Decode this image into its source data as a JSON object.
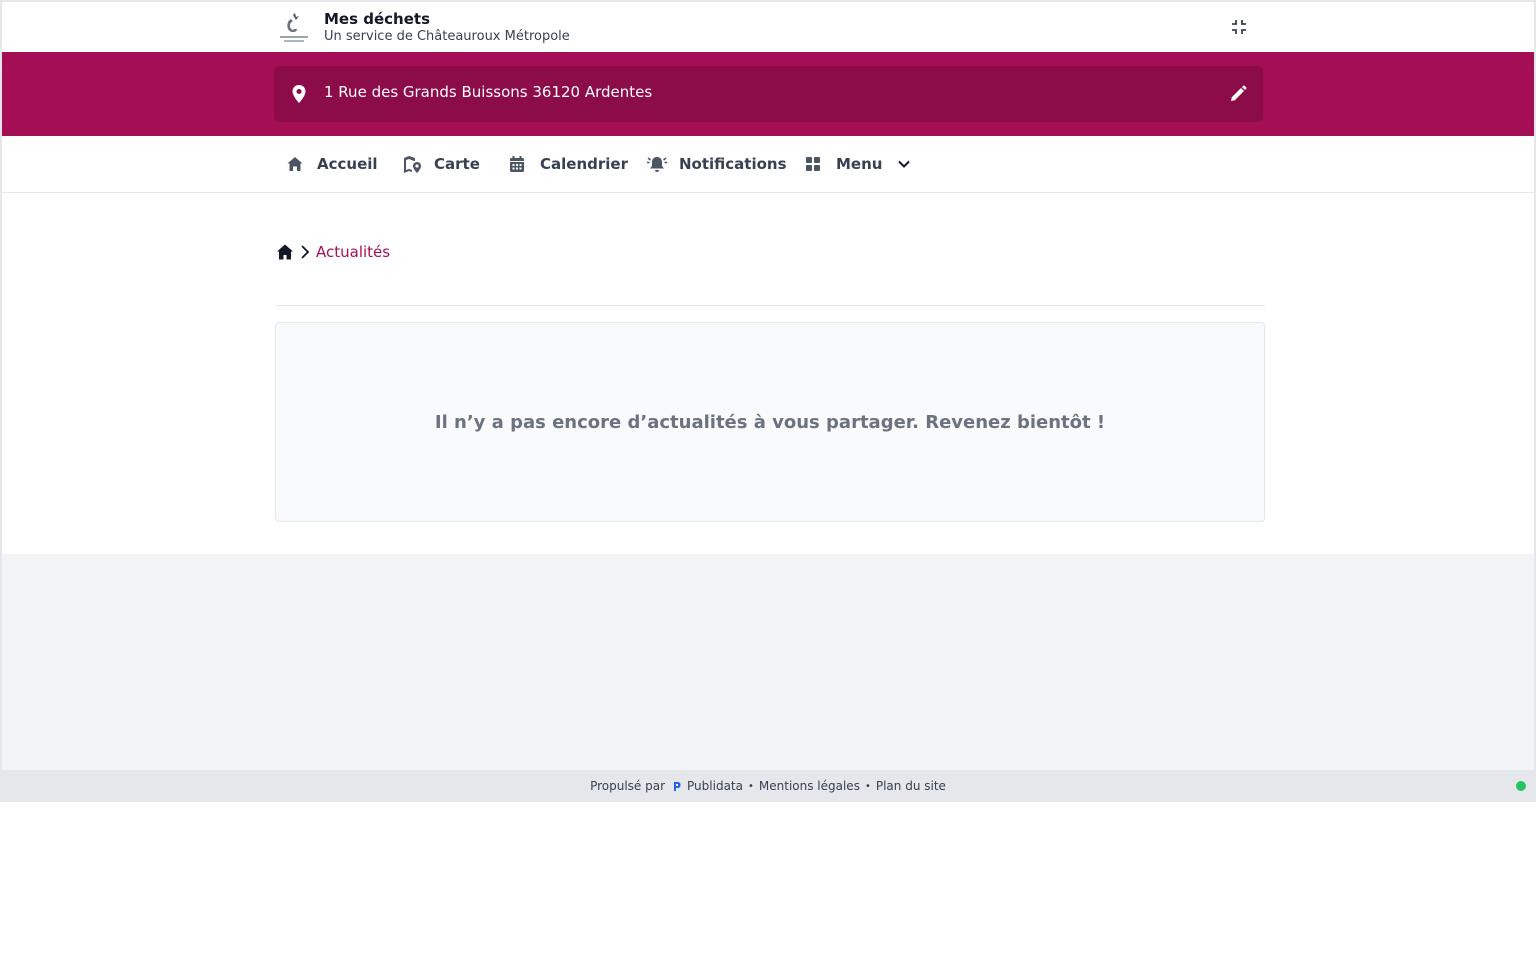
{
  "header": {
    "title": "Mes déchets",
    "subtitle": "Un service de Châteauroux Métropole",
    "logo_alt": "CHÂTEAUROUX MÉTROPOLE"
  },
  "address": {
    "text": "1 Rue des Grands Buissons 36120 Ardentes"
  },
  "nav": {
    "items": [
      {
        "label": "Accueil",
        "icon": "home-icon"
      },
      {
        "label": "Carte",
        "icon": "map-pin-icon"
      },
      {
        "label": "Calendrier",
        "icon": "calendar-icon"
      },
      {
        "label": "Notifications",
        "icon": "bell-icon"
      },
      {
        "label": "Menu",
        "icon": "grid-icon"
      }
    ]
  },
  "breadcrumb": {
    "current": "Actualités"
  },
  "main": {
    "empty_message": "Il n’y a pas encore d’actualités à vous partager. Revenez bientôt !"
  },
  "footer": {
    "powered_by": "Propulsé par",
    "brand": "Publidata",
    "legal": "Mentions légales",
    "sitemap": "Plan du site"
  },
  "colors": {
    "accent": "#a30e55",
    "accent_dark": "#8c0b49",
    "status": "#22c55e"
  }
}
